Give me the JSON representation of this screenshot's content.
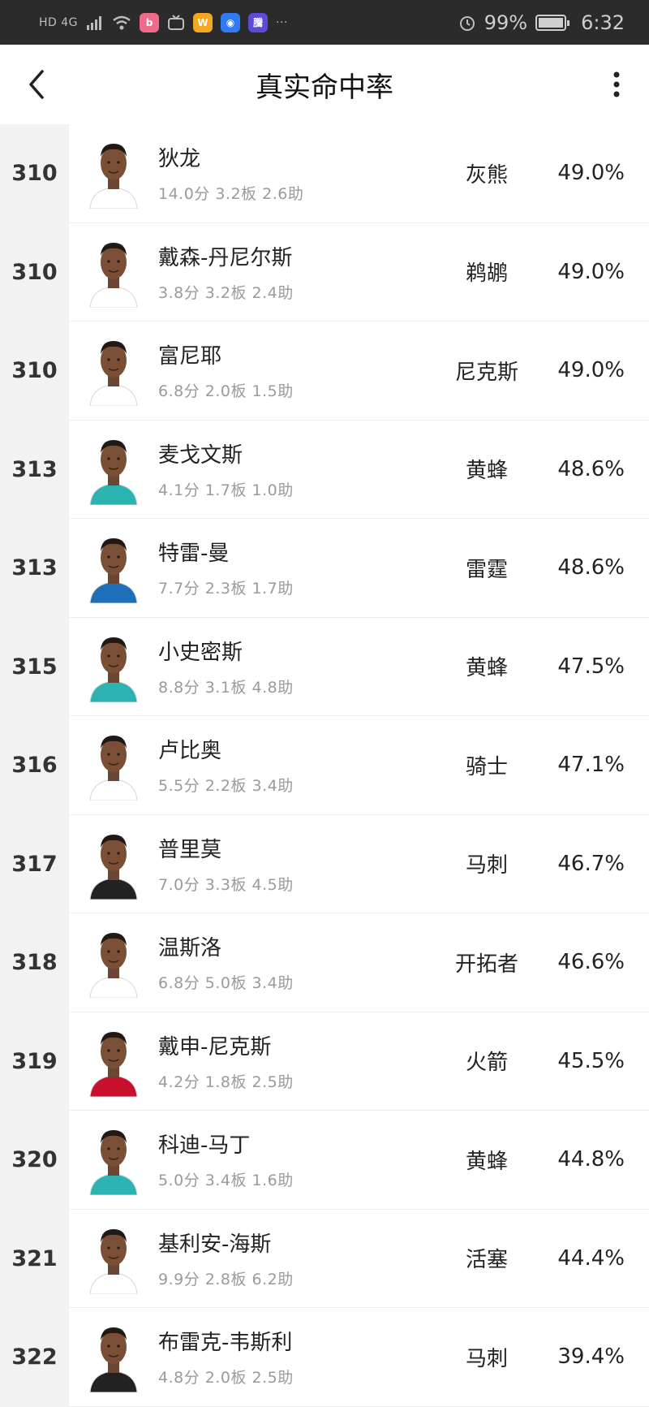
{
  "status_bar": {
    "network": "HD 4G",
    "battery": "99%",
    "time": "6:32",
    "app_icons": [
      "bilibili-icon",
      "tv-icon",
      "weibo-icon",
      "bulb-icon",
      "app-icon"
    ],
    "overflow": "···"
  },
  "header": {
    "title": "真实命中率"
  },
  "rows": [
    {
      "rank": "310",
      "name": "狄龙",
      "stats": "14.0分  3.2板  2.6助",
      "team": "灰熊",
      "pct": "49.0%",
      "jersey": "#ffffff"
    },
    {
      "rank": "310",
      "name": "戴森-丹尼尔斯",
      "stats": "3.8分  3.2板  2.4助",
      "team": "鹈鹕",
      "pct": "49.0%",
      "jersey": "#ffffff"
    },
    {
      "rank": "310",
      "name": "富尼耶",
      "stats": "6.8分  2.0板  1.5助",
      "team": "尼克斯",
      "pct": "49.0%",
      "jersey": "#ffffff"
    },
    {
      "rank": "313",
      "name": "麦戈文斯",
      "stats": "4.1分  1.7板  1.0助",
      "team": "黄蜂",
      "pct": "48.6%",
      "jersey": "#2bb3b1"
    },
    {
      "rank": "313",
      "name": "特雷-曼",
      "stats": "7.7分  2.3板  1.7助",
      "team": "雷霆",
      "pct": "48.6%",
      "jersey": "#1d6fb8"
    },
    {
      "rank": "315",
      "name": "小史密斯",
      "stats": "8.8分  3.1板  4.8助",
      "team": "黄蜂",
      "pct": "47.5%",
      "jersey": "#2bb3b1"
    },
    {
      "rank": "316",
      "name": "卢比奥",
      "stats": "5.5分  2.2板  3.4助",
      "team": "骑士",
      "pct": "47.1%",
      "jersey": "#ffffff"
    },
    {
      "rank": "317",
      "name": "普里莫",
      "stats": "7.0分  3.3板  4.5助",
      "team": "马刺",
      "pct": "46.7%",
      "jersey": "#222222"
    },
    {
      "rank": "318",
      "name": "温斯洛",
      "stats": "6.8分  5.0板  3.4助",
      "team": "开拓者",
      "pct": "46.6%",
      "jersey": "#ffffff"
    },
    {
      "rank": "319",
      "name": "戴申-尼克斯",
      "stats": "4.2分  1.8板  2.5助",
      "team": "火箭",
      "pct": "45.5%",
      "jersey": "#c8102e"
    },
    {
      "rank": "320",
      "name": "科迪-马丁",
      "stats": "5.0分  3.4板  1.6助",
      "team": "黄蜂",
      "pct": "44.8%",
      "jersey": "#2bb3b1"
    },
    {
      "rank": "321",
      "name": "基利安-海斯",
      "stats": "9.9分  2.8板  6.2助",
      "team": "活塞",
      "pct": "44.4%",
      "jersey": "#ffffff"
    },
    {
      "rank": "322",
      "name": "布雷克-韦斯利",
      "stats": "4.8分  2.0板  2.5助",
      "team": "马刺",
      "pct": "39.4%",
      "jersey": "#222222"
    }
  ]
}
